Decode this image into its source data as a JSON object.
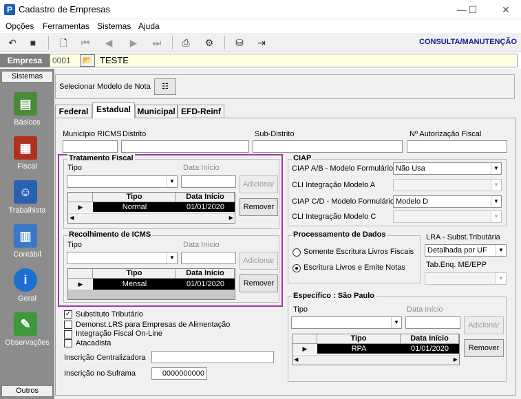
{
  "window": {
    "title": "Cadastro de Empresas",
    "minimize": "—",
    "maximize": "☐",
    "close": "✕"
  },
  "menu": [
    "Opções",
    "Ferramentas",
    "Sistemas",
    "Ajuda"
  ],
  "mode_label": "CONSULTA/MANUTENÇÃO",
  "empresa": {
    "label": "Empresa",
    "code": "0001",
    "name": "TESTE"
  },
  "sidebar": {
    "header": "Sistemas",
    "footer": "Outros",
    "items": [
      {
        "label": "Básicos",
        "icon": "notebook-icon",
        "color": "#4a8a3a"
      },
      {
        "label": "Fiscal",
        "icon": "ledger-icon",
        "color": "#b03020"
      },
      {
        "label": "Trabalhista",
        "icon": "worker-icon",
        "color": "#2a60b0"
      },
      {
        "label": "Contábil",
        "icon": "calculator-icon",
        "color": "#3a78c8"
      },
      {
        "label": "Geral",
        "icon": "info-icon",
        "color": "#1b6fd0"
      },
      {
        "label": "Observações",
        "icon": "notes-icon",
        "color": "#3a9a3a"
      }
    ]
  },
  "modelo_nota": {
    "label": "Selecionar Modelo de Nota"
  },
  "tabs": [
    "Federal",
    "Estadual",
    "Municipal",
    "EFD-Reinf"
  ],
  "active_tab": "Estadual",
  "fields": {
    "municipio": "Município RICMS",
    "distrito": "Distrito",
    "subdistrito": "Sub-Distrito",
    "autorizacao": "Nº Autorização Fiscal"
  },
  "tratamento": {
    "title": "Tratamento Fiscal",
    "tipo_label": "Tipo",
    "data_label": "Data Início",
    "add": "Adicionar",
    "remove": "Remover",
    "col_tipo": "Tipo",
    "col_data": "Data Início",
    "row_tipo": "Normal",
    "row_data": "01/01/2020"
  },
  "recolhimento": {
    "title": "Recolhimento de ICMS",
    "tipo_label": "Tipo",
    "data_label": "Data Início",
    "add": "Adicionar",
    "remove": "Remover",
    "col_tipo": "Tipo",
    "col_data": "Data Início",
    "row_tipo": "Mensal",
    "row_data": "01/01/2020"
  },
  "ciap": {
    "title": "CIAP",
    "ab_label": "CIAP  A/B - Modelo Formulário",
    "ab_value": "Não Usa",
    "cli_a_label": "CLI Integração Modelo A",
    "cd_label": "CIAP C/D - Modelo Formulário",
    "cd_value": "Modelo D",
    "cli_c_label": "CLI Integração Modelo C"
  },
  "processamento": {
    "title": "Processamento de Dados",
    "opt1": "Somente Escritura Livros Fiscais",
    "opt2": "Escritura Livros e Emite Notas"
  },
  "lra": {
    "label": "LRA - Subst.Tributária",
    "value": "Detalhada por UF",
    "tab_label": "Tab.Enq. ME/EPP"
  },
  "checks": {
    "substituto": "Substituto Tributário",
    "demonst": "Demonst.LRS para Empresas de Alimentação",
    "integracao": "Integração Fiscal On-Line",
    "atacadista": "Atacadista"
  },
  "inscricao": {
    "centralizadora": "Inscrição Centralizadora",
    "suframa": "Inscrição no Suframa",
    "suframa_value": "0000000000"
  },
  "especifico": {
    "title": "Específico : São Paulo",
    "tipo_label": "Tipo",
    "data_label": "Data Início",
    "add": "Adicionar",
    "remove": "Remover",
    "col_tipo": "Tipo",
    "col_data": "Data Início",
    "row_tipo": "RPA",
    "row_data": "01/01/2020"
  }
}
